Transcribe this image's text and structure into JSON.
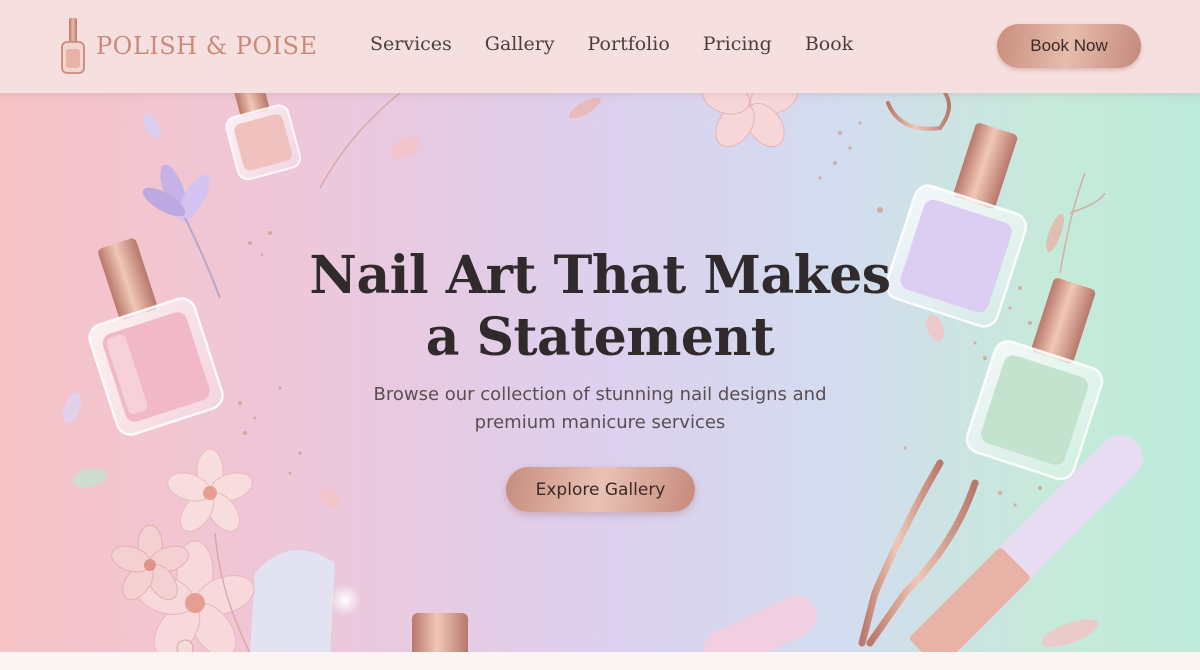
{
  "brand": {
    "name": "POLISH & POISE",
    "logo_icon": "nail-polish-bottle-icon",
    "color": "#c98b7c"
  },
  "nav": {
    "items": [
      {
        "label": "Services"
      },
      {
        "label": "Gallery"
      },
      {
        "label": "Portfolio"
      },
      {
        "label": "Pricing"
      },
      {
        "label": "Book"
      }
    ],
    "cta_label": "Book Now"
  },
  "hero": {
    "title_line1": "Nail Art That Makes",
    "title_line2": "a Statement",
    "subtitle_line1": "Browse our collection of stunning nail designs and",
    "subtitle_line2": "premium manicure services",
    "cta_label": "Explore Gallery",
    "decorations": [
      "nail-polish-bottle-icon",
      "flower-icon",
      "nail-file-icon",
      "cuticle-nipper-icon",
      "glitter-icon",
      "petal-icon"
    ]
  },
  "colors": {
    "accent": "#d09a8a",
    "gradient_left": "#f6c3c6",
    "gradient_mid": "#ddd0ee",
    "gradient_right": "#bdeadb",
    "text_dark": "#302a2c"
  }
}
